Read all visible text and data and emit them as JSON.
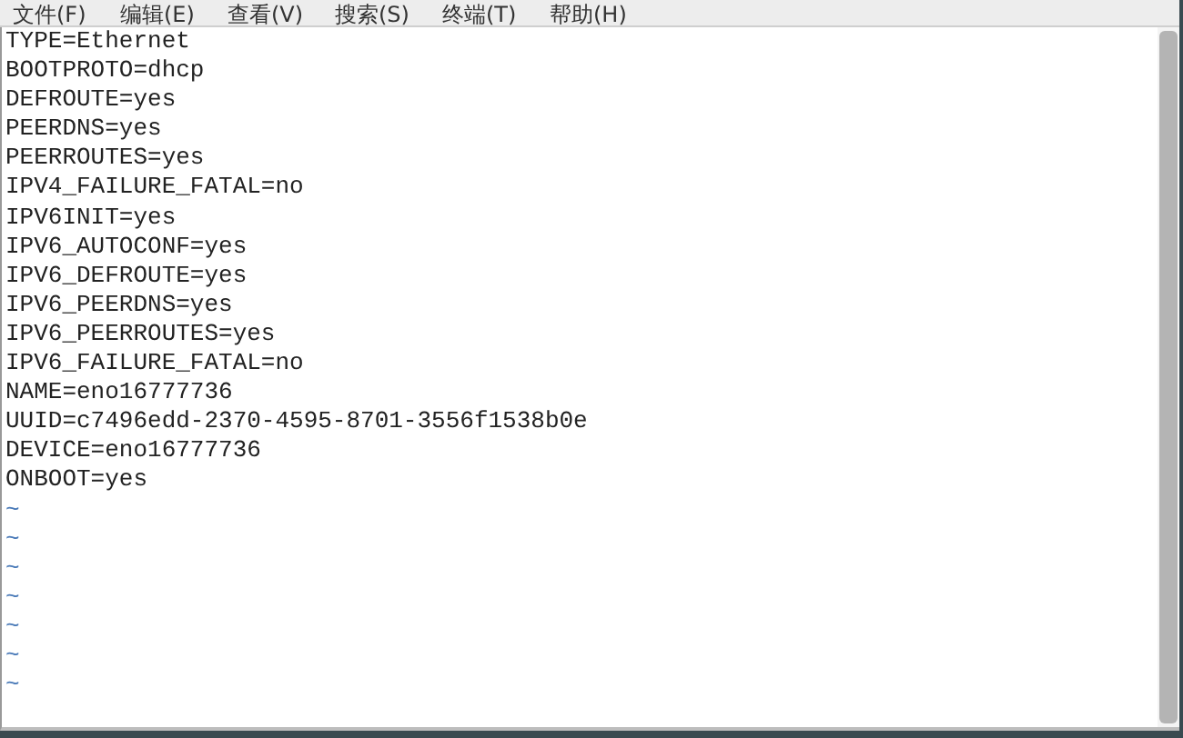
{
  "menu_bar": [
    "文件(F)",
    "编辑(E)",
    "查看(V)",
    "搜索(S)",
    "终端(T)",
    "帮助(H)"
  ],
  "editor": {
    "lines": [
      "TYPE=Ethernet",
      "BOOTPROTO=dhcp",
      "DEFROUTE=yes",
      "PEERDNS=yes",
      "PEERROUTES=yes",
      "IPV4_FAILURE_FATAL=no",
      "IPV6INIT=yes",
      "IPV6_AUTOCONF=yes",
      "IPV6_DEFROUTE=yes",
      "IPV6_PEERDNS=yes",
      "IPV6_PEERROUTES=yes",
      "IPV6_FAILURE_FATAL=no",
      "NAME=eno16777736",
      "UUID=c7496edd-2370-4595-8701-3556f1538b0e",
      "DEVICE=eno16777736",
      "ONBOOT=yes"
    ],
    "empty_line_markers": [
      "~",
      "~",
      "~",
      "~",
      "~",
      "~",
      "~"
    ]
  }
}
